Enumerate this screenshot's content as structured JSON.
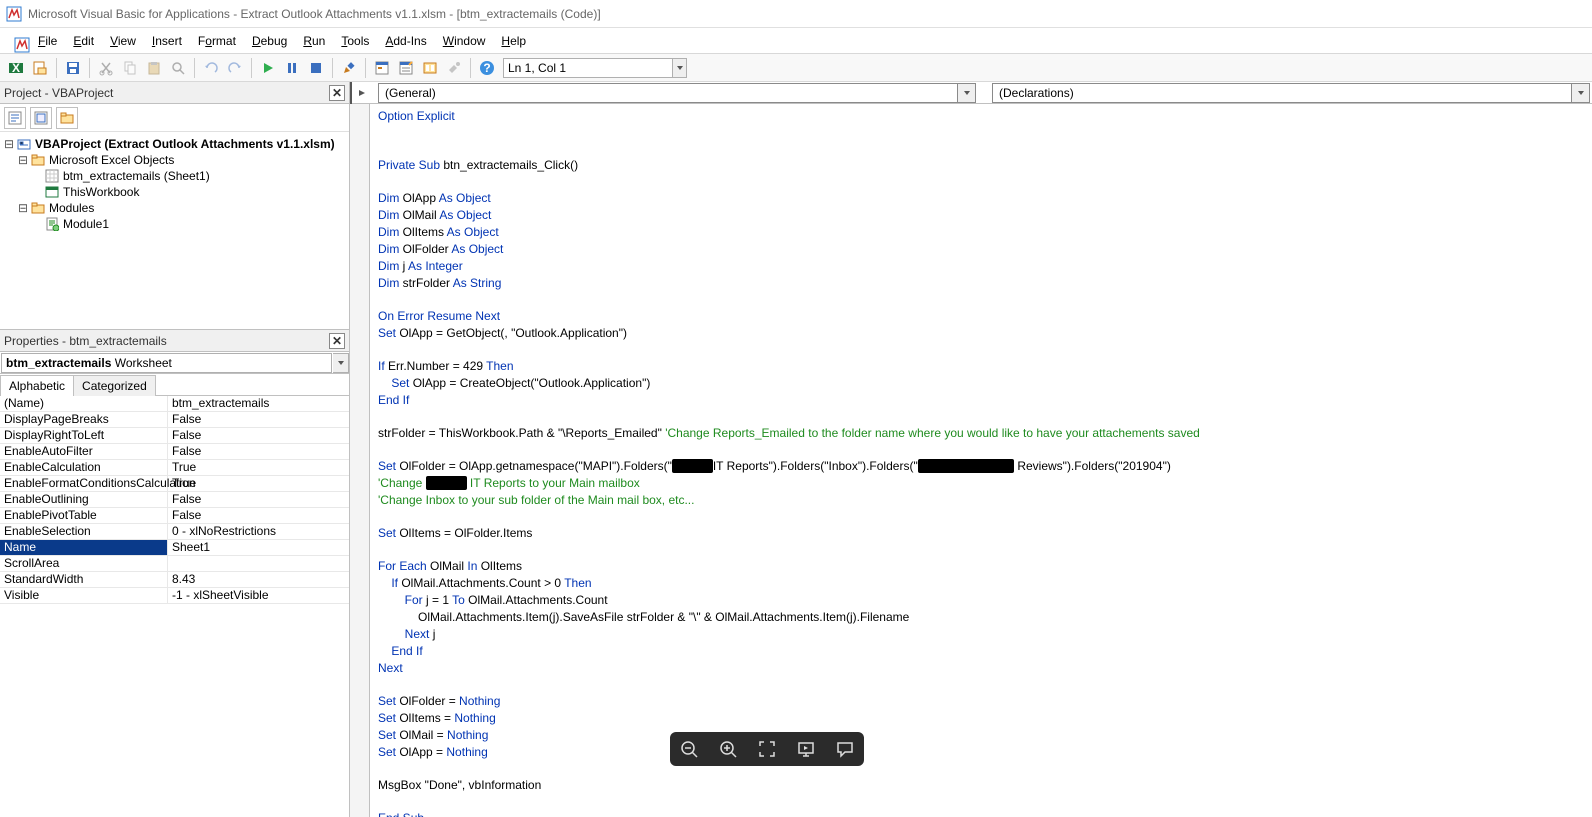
{
  "titlebar": "Microsoft Visual Basic for Applications - Extract Outlook Attachments v1.1.xlsm - [btm_extractemails (Code)]",
  "menu": [
    "File",
    "Edit",
    "View",
    "Insert",
    "Format",
    "Debug",
    "Run",
    "Tools",
    "Add-Ins",
    "Window",
    "Help"
  ],
  "lncol": "Ln 1, Col 1",
  "project": {
    "title": "Project - VBAProject",
    "root": "VBAProject (Extract Outlook Attachments v1.1.xlsm)",
    "excelObjects": "Microsoft Excel Objects",
    "sheet": "btm_extractemails (Sheet1)",
    "thiswb": "ThisWorkbook",
    "modules": "Modules",
    "module1": "Module1"
  },
  "properties": {
    "title": "Properties - btm_extractemails",
    "objectName": "btm_extractemails",
    "objectType": "Worksheet",
    "tabs": [
      "Alphabetic",
      "Categorized"
    ],
    "rows": [
      {
        "n": "(Name)",
        "v": "btm_extractemails"
      },
      {
        "n": "DisplayPageBreaks",
        "v": "False"
      },
      {
        "n": "DisplayRightToLeft",
        "v": "False"
      },
      {
        "n": "EnableAutoFilter",
        "v": "False"
      },
      {
        "n": "EnableCalculation",
        "v": "True"
      },
      {
        "n": "EnableFormatConditionsCalculation",
        "v": "True"
      },
      {
        "n": "EnableOutlining",
        "v": "False"
      },
      {
        "n": "EnablePivotTable",
        "v": "False"
      },
      {
        "n": "EnableSelection",
        "v": "0 - xlNoRestrictions"
      },
      {
        "n": "Name",
        "v": "Sheet1",
        "sel": true
      },
      {
        "n": "ScrollArea",
        "v": ""
      },
      {
        "n": "StandardWidth",
        "v": "8.43"
      },
      {
        "n": "Visible",
        "v": "-1 - xlSheetVisible"
      }
    ]
  },
  "editor": {
    "object": "(General)",
    "procedure": "(Declarations)"
  },
  "code": {
    "l1a": "Option Explicit",
    "l2a": "Private Sub",
    "l2b": " btn_extractemails_Click()",
    "l3a": "Dim",
    "l3b": " OlApp ",
    "l3c": "As Object",
    "l4a": "Dim",
    "l4b": " OlMail ",
    "l4c": "As Object",
    "l5a": "Dim",
    "l5b": " OlItems ",
    "l5c": "As Object",
    "l6a": "Dim",
    "l6b": " OlFolder ",
    "l6c": "As Object",
    "l7a": "Dim",
    "l7b": " j ",
    "l7c": "As Integer",
    "l8a": "Dim",
    "l8b": " strFolder ",
    "l8c": "As String",
    "l9a": "On Error Resume Next",
    "l10a": "Set",
    "l10b": " OlApp = GetObject(, \"Outlook.Application\")",
    "l11a": "If",
    "l11b": " Err.Number = 429 ",
    "l11c": "Then",
    "l12a": "    Set",
    "l12b": " OlApp = CreateObject(\"Outlook.Application\")",
    "l13a": "End If",
    "l14a": "strFolder = ThisWorkbook.Path & \"\\Reports_Emailed\" ",
    "l14b": "'Change Reports_Emailed to the folder name where you would like to have your attachements saved",
    "l15a": "Set",
    "l15b": " OlFolder = OlApp.getnamespace(\"MAPI\").Folders(\"",
    "l15c": "IT Reports\").Folders(\"Inbox\").Folders(\"",
    "l15d": " Reviews\").Folders(\"201904\")",
    "l16a": "'Change ",
    "l16b": " IT Reports to your Main mailbox",
    "l17a": "'Change Inbox to your sub folder of the Main mail box, etc...",
    "l18a": "Set",
    "l18b": " OlItems = OlFolder.Items",
    "l19a": "For Each",
    "l19b": " OlMail ",
    "l19c": "In",
    "l19d": " OlItems",
    "l20a": "    If",
    "l20b": " OlMail.Attachments.Count > 0 ",
    "l20c": "Then",
    "l21a": "        For",
    "l21b": " j = 1 ",
    "l21c": "To",
    "l21d": " OlMail.Attachments.Count",
    "l22a": "            OlMail.Attachments.Item(j).SaveAsFile strFolder & \"\\\" & OlMail.Attachments.Item(j).Filename",
    "l23a": "        Next",
    "l23b": " j",
    "l24a": "    End If",
    "l25a": "Next",
    "l26a": "Set",
    "l26b": " OlFolder = ",
    "l26c": "Nothing",
    "l27a": "Set",
    "l27b": " OlItems = ",
    "l27c": "Nothing",
    "l28a": "Set",
    "l28b": " OlMail = ",
    "l28c": "Nothing",
    "l29a": "Set",
    "l29b": " OlApp = ",
    "l29c": "Nothing",
    "l30a": "MsgBox \"Done\", vbInformation",
    "l31a": "End Sub"
  }
}
